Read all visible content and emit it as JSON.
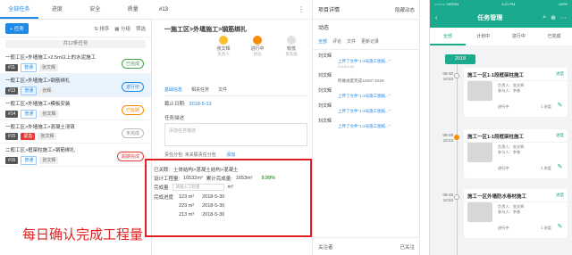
{
  "desktop": {
    "tabs": [
      "全部任务",
      "进度",
      "安全",
      "质量"
    ],
    "list_toolbar": {
      "new_label": "+ 任务",
      "sort_label": "排序",
      "group_label": "分组",
      "filter_label": "筛选"
    },
    "group_head": "共12条任务",
    "tasks": [
      {
        "title": "一般工区>外墙施工>2.5m以上的水泥施工",
        "num": "#11",
        "priority": "普通",
        "owner": "张文辉",
        "status": "已完成"
      },
      {
        "title": "一般工区>外墙施工>钢筋绑扎",
        "num": "#13",
        "priority": "普通",
        "owner": "张辉",
        "status": "进行中"
      },
      {
        "title": "一般工区>外墙施工>模板安装",
        "num": "#14",
        "priority": "普通",
        "owner": "张文辉",
        "status": "已延期"
      },
      {
        "title": "一般工区>外墙施工>混凝土浇筑",
        "num": "#15",
        "priority": "紧急",
        "owner": "张文辉",
        "status": "未完成"
      },
      {
        "title": "二般工区>框架柱施工>钢筋绑扎",
        "num": "#16",
        "priority": "普通",
        "owner": "张文辉",
        "status": "超期完成"
      }
    ],
    "detail": {
      "num": "#13",
      "menu_icon": "ellipsis",
      "title": "一施工区>外墙施工>钢筋绑扎",
      "assignee": {
        "label": "张文辉",
        "sub": "负责人"
      },
      "state": {
        "label": "进行中",
        "sub": "状态"
      },
      "priority": {
        "label": "较低",
        "sub": "优先级"
      },
      "subtabs": [
        "基础信息",
        "相关任务",
        "文件"
      ],
      "due_label": "截止日期:",
      "due_value": "2018-6-13",
      "desc_label": "任务描述",
      "desc_placeholder": "添加任务描述",
      "related_label": "责任分包:",
      "related_value": "添加",
      "related_value2": "未关联责任分包"
    },
    "quantity": {
      "linked_label": "已关联:",
      "linked_value": "土体结构>混凝土结构>混凝土",
      "design_label": "设计工程量:",
      "design_value": "16532m³",
      "accum_label": "累计完成量:",
      "accum_value": "1653m³",
      "percent": "9.99%",
      "done_label": "完成量",
      "input_placeholder": "请输入工程量",
      "unit": "m³",
      "history_label": "完成进度",
      "history": [
        {
          "qty": "123 m³",
          "date": "2018-5-30"
        },
        {
          "qty": "223 m³",
          "date": "2018-5-30"
        },
        {
          "qty": "213 m³",
          "date": "2018-5-30"
        }
      ]
    },
    "caption": "每日确认完成工程量",
    "activity": {
      "title": "动态",
      "right_label": "隐藏动态",
      "tabs": [
        "全部",
        "评论",
        "文件",
        "更新记录"
      ],
      "items": [
        {
          "name": "刘文辉",
          "text": "上传了文件\"1-2号施工图纸...\"",
          "time": "2018-5-30"
        },
        {
          "name": "刘文辉",
          "text": "所做进度完成123m³ 2018-",
          "time": ""
        },
        {
          "name": "刘文辉",
          "text": "上传了文件\"1-2号施工图纸...\"",
          "time": ""
        },
        {
          "name": "刘文辉",
          "text": "上传了文件\"1-2号施工图纸...\"",
          "time": ""
        },
        {
          "name": "刘文辉",
          "text": "上传了文件\"1-2号施工图纸...\"",
          "time": ""
        }
      ],
      "foot_left": "关注者",
      "foot_right": "已关注"
    },
    "top_right_label": "项目详情",
    "top_right_label2": "隐藏动态"
  },
  "phone": {
    "status_carrier": "○○○○○ VIRGIN",
    "status_time": "4:21 PM",
    "status_battery": "100%",
    "nav_title": "任务管理",
    "nav_back_icon": "chevron-left",
    "nav_icons": [
      "search-icon",
      "add-icon",
      "more-icon"
    ],
    "tabs": [
      "全部",
      "计划中",
      "进行中",
      "已完成"
    ],
    "year": "2018",
    "entries": [
      {
        "date": "08-30",
        "time": "10:53",
        "title": "施工一区1-1段框架柱施工",
        "state": "进度",
        "owner": "负责人：张文辉",
        "participant": "参与人：李香",
        "status": "进行中",
        "count": "1 进度",
        "dot": "gray"
      },
      {
        "date": "08-29",
        "time": "10:23",
        "title": "施工一区1-1段框架柱施工",
        "state": "进度",
        "owner": "负责人：张文辉",
        "participant": "参与人：李香",
        "status": "进行中",
        "count": "1 进度",
        "dot": "orange"
      },
      {
        "date": "08-28",
        "time": "10:53",
        "title": "施工一区外墙防水卷材施工",
        "state": "进度",
        "owner": "负责人：张文辉",
        "participant": "参与人：李香",
        "status": "进行中",
        "count": "1 进度",
        "dot": "gray"
      }
    ]
  }
}
